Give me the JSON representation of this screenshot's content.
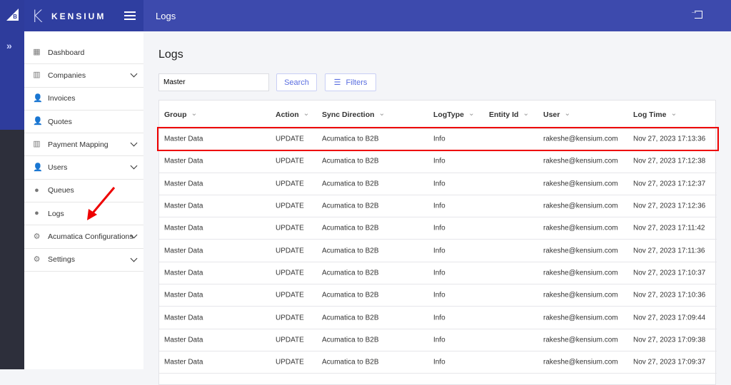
{
  "brand": {
    "name": "KENSIUM",
    "logo_letter": "K",
    "platform_logo": "B"
  },
  "header": {
    "title": "Logs"
  },
  "sidebar": {
    "items": [
      {
        "label": "Dashboard",
        "icon": "grid-icon",
        "chev": false
      },
      {
        "label": "Companies",
        "icon": "building-icon",
        "chev": true
      },
      {
        "label": "Invoices",
        "icon": "user-icon",
        "chev": false
      },
      {
        "label": "Quotes",
        "icon": "user-icon",
        "chev": false
      },
      {
        "label": "Payment Mapping",
        "icon": "building-icon",
        "chev": true
      },
      {
        "label": "Users",
        "icon": "user-icon",
        "chev": true
      },
      {
        "label": "Queues",
        "icon": "user-circle-icon",
        "chev": false
      },
      {
        "label": "Logs",
        "icon": "user-circle-icon",
        "chev": false
      },
      {
        "label": "Acumatica Configurations",
        "icon": "gear-icon",
        "chev": true
      },
      {
        "label": "Settings",
        "icon": "gear-icon",
        "chev": true
      }
    ]
  },
  "page": {
    "title": "Logs",
    "search_value": "Master",
    "search_label": "Search",
    "filters_label": "Filters"
  },
  "table": {
    "columns": [
      "Group",
      "Action",
      "Sync Direction",
      "LogType",
      "Entity Id",
      "User",
      "Log Time"
    ],
    "rows": [
      [
        "Master Data",
        "UPDATE",
        "Acumatica to B2B",
        "Info",
        "",
        "rakeshe@kensium.com",
        "Nov 27, 2023 17:13:36"
      ],
      [
        "Master Data",
        "UPDATE",
        "Acumatica to B2B",
        "Info",
        "",
        "rakeshe@kensium.com",
        "Nov 27, 2023 17:12:38"
      ],
      [
        "Master Data",
        "UPDATE",
        "Acumatica to B2B",
        "Info",
        "",
        "rakeshe@kensium.com",
        "Nov 27, 2023 17:12:37"
      ],
      [
        "Master Data",
        "UPDATE",
        "Acumatica to B2B",
        "Info",
        "",
        "rakeshe@kensium.com",
        "Nov 27, 2023 17:12:36"
      ],
      [
        "Master Data",
        "UPDATE",
        "Acumatica to B2B",
        "Info",
        "",
        "rakeshe@kensium.com",
        "Nov 27, 2023 17:11:42"
      ],
      [
        "Master Data",
        "UPDATE",
        "Acumatica to B2B",
        "Info",
        "",
        "rakeshe@kensium.com",
        "Nov 27, 2023 17:11:36"
      ],
      [
        "Master Data",
        "UPDATE",
        "Acumatica to B2B",
        "Info",
        "",
        "rakeshe@kensium.com",
        "Nov 27, 2023 17:10:37"
      ],
      [
        "Master Data",
        "UPDATE",
        "Acumatica to B2B",
        "Info",
        "",
        "rakeshe@kensium.com",
        "Nov 27, 2023 17:10:36"
      ],
      [
        "Master Data",
        "UPDATE",
        "Acumatica to B2B",
        "Info",
        "",
        "rakeshe@kensium.com",
        "Nov 27, 2023 17:09:44"
      ],
      [
        "Master Data",
        "UPDATE",
        "Acumatica to B2B",
        "Info",
        "",
        "rakeshe@kensium.com",
        "Nov 27, 2023 17:09:38"
      ],
      [
        "Master Data",
        "UPDATE",
        "Acumatica to B2B",
        "Info",
        "",
        "rakeshe@kensium.com",
        "Nov 27, 2023 17:09:37"
      ]
    ]
  },
  "colors": {
    "header": "#3d4aad",
    "highlight": "#ee0000",
    "accent": "#5b6fe0"
  }
}
